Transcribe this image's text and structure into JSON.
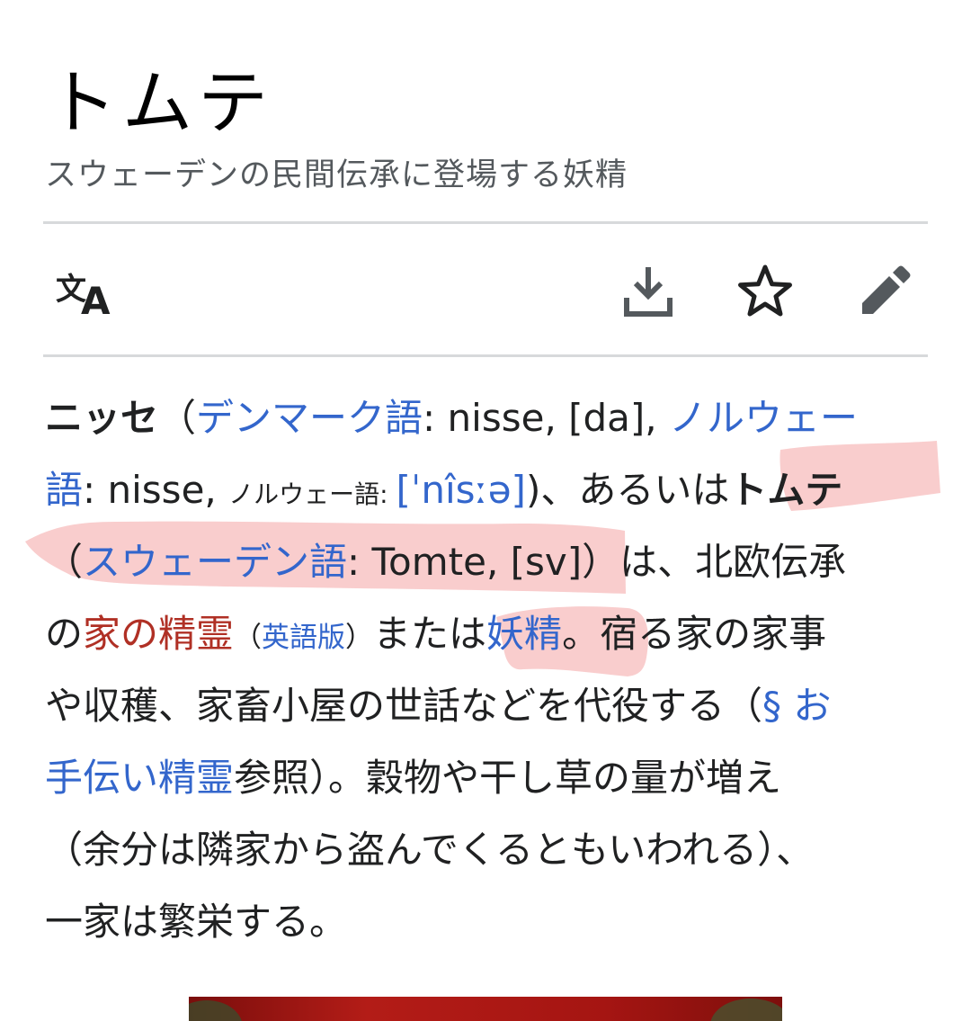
{
  "page": {
    "title": "トムテ",
    "subtitle": "スウェーデンの民間伝承に登場する妖精"
  },
  "toolbar": {
    "language_icon_glyph_kanji": "文",
    "language_icon_glyph_latin": "A",
    "icons": [
      "language-icon",
      "download-icon",
      "star-icon",
      "edit-pencil-icon"
    ]
  },
  "colors": {
    "link": "#3366cc",
    "red_link": "#b03025",
    "highlight": "#f8c4c4",
    "subtitle": "#54595d"
  },
  "article": {
    "l1": {
      "bold": "ニッセ",
      "paren_open": "（",
      "link_danish": "デンマーク語",
      "t1": ": nisse, [da], ",
      "link_norwegian_part": "ノルウェー"
    },
    "l2": {
      "link_norwegian_rest": "語",
      "t1": ": nisse, ",
      "small_norwegian": "ノルウェー語: ",
      "link_ipa": "[ˈnîsːə]",
      "t2": ")、あるいは",
      "bold_tomte": "トムテ"
    },
    "l3": {
      "paren_open": "（",
      "link_swedish": "スウェーデン語",
      "t1": ": Tomte, [sv]）は、北欧伝承"
    },
    "l4": {
      "t1": "の",
      "link_house_spirit": "家の精霊",
      "small_paren_open": "（",
      "link_english": "英語版",
      "small_paren_close": "）",
      "t2": "または",
      "link_fairy": "妖精",
      "t3": "。宿る家の家事"
    },
    "l5": {
      "t1": "や収穫、家畜小屋の世話などを代役する（",
      "link_section_part": "§ お"
    },
    "l6": {
      "link_section_rest": "手伝い精霊",
      "t1": "参照）。穀物や干し草の量が増え"
    },
    "l7": {
      "t1": "（余分は隣家から盗んでくるともいわれる）、"
    },
    "l8": {
      "t1": "一家は繁栄する。"
    }
  }
}
